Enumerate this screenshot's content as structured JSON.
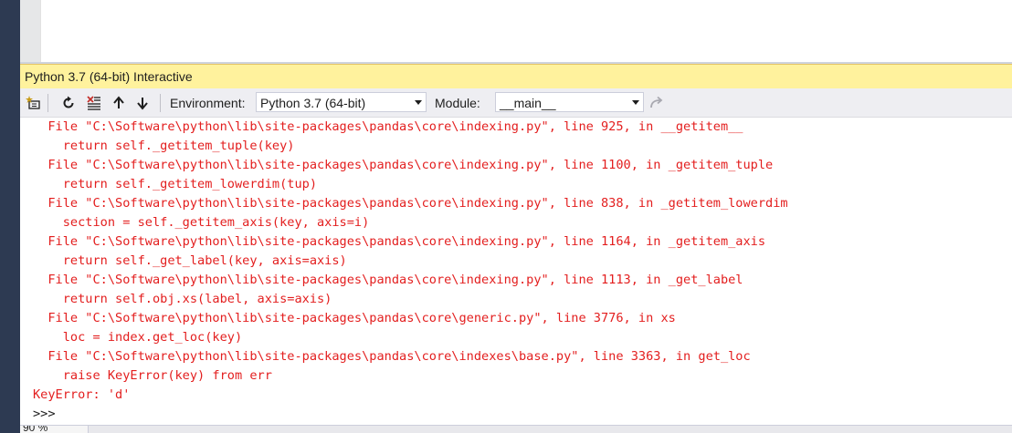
{
  "window": {
    "title": "Python 3.7 (64-bit) Interactive"
  },
  "toolbar": {
    "environment_label": "Environment:",
    "environment_value": "Python 3.7 (64-bit)",
    "module_label": "Module:",
    "module_value": "__main__",
    "icons": [
      "new-plus-icon",
      "reset-icon",
      "clear-icon",
      "history-up-icon",
      "history-down-icon",
      "redo-icon"
    ]
  },
  "output": {
    "lines": [
      {
        "text": "  File \"C:\\Software\\python\\lib\\site-packages\\pandas\\core\\indexing.py\", line 925, in __getitem__",
        "kind": "error"
      },
      {
        "text": "    return self._getitem_tuple(key)",
        "kind": "error"
      },
      {
        "text": "  File \"C:\\Software\\python\\lib\\site-packages\\pandas\\core\\indexing.py\", line 1100, in _getitem_tuple",
        "kind": "error"
      },
      {
        "text": "    return self._getitem_lowerdim(tup)",
        "kind": "error"
      },
      {
        "text": "  File \"C:\\Software\\python\\lib\\site-packages\\pandas\\core\\indexing.py\", line 838, in _getitem_lowerdim",
        "kind": "error"
      },
      {
        "text": "    section = self._getitem_axis(key, axis=i)",
        "kind": "error"
      },
      {
        "text": "  File \"C:\\Software\\python\\lib\\site-packages\\pandas\\core\\indexing.py\", line 1164, in _getitem_axis",
        "kind": "error"
      },
      {
        "text": "    return self._get_label(key, axis=axis)",
        "kind": "error"
      },
      {
        "text": "  File \"C:\\Software\\python\\lib\\site-packages\\pandas\\core\\indexing.py\", line 1113, in _get_label",
        "kind": "error"
      },
      {
        "text": "    return self.obj.xs(label, axis=axis)",
        "kind": "error"
      },
      {
        "text": "  File \"C:\\Software\\python\\lib\\site-packages\\pandas\\core\\generic.py\", line 3776, in xs",
        "kind": "error"
      },
      {
        "text": "    loc = index.get_loc(key)",
        "kind": "error"
      },
      {
        "text": "  File \"C:\\Software\\python\\lib\\site-packages\\pandas\\core\\indexes\\base.py\", line 3363, in get_loc",
        "kind": "error"
      },
      {
        "text": "    raise KeyError(key) from err",
        "kind": "error"
      },
      {
        "text": "KeyError: 'd'",
        "kind": "error"
      },
      {
        "text": ">>>",
        "kind": "prompt"
      }
    ]
  },
  "status": {
    "zoom": "90 %"
  },
  "colors": {
    "error_text": "#e31e1e",
    "titlebar_bg": "#fff29d",
    "left_strip": "#2d3a52"
  }
}
